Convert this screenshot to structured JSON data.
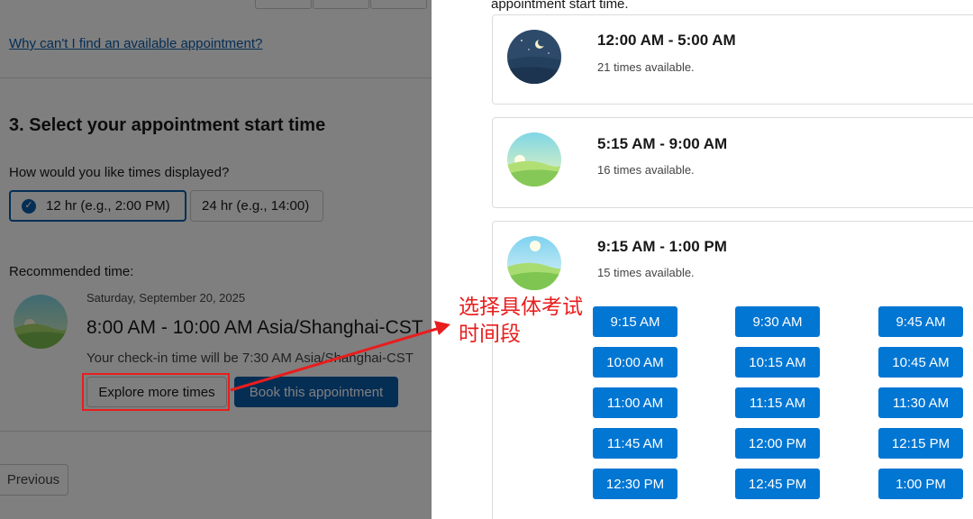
{
  "left_panel": {
    "why_link": "Why can't I find an available appointment?",
    "step_title": "3. Select your appointment start time",
    "format_question": "How would you like times displayed?",
    "format_options": [
      {
        "label": "12 hr (e.g., 2:00 PM)",
        "selected": true
      },
      {
        "label": "24 hr (e.g., 14:00)",
        "selected": false
      }
    ],
    "recommended_label": "Recommended time:",
    "recommended": {
      "date": "Saturday, September 20, 2025",
      "time_range": "8:00 AM - 10:00 AM Asia/Shanghai-CST",
      "checkin": "Your check-in time will be 7:30 AM Asia/Shanghai-CST"
    },
    "explore_button": "Explore more times",
    "book_button": "Book this appointment",
    "previous_button": "Previous"
  },
  "annotation": {
    "text_line1": "选择具体考试",
    "text_line2": "时间段",
    "color": "#e81d1d"
  },
  "right_panel": {
    "heading": "appointment start time.",
    "periods": [
      {
        "title": "12:00 AM - 5:00 AM",
        "availability": "21 times available.",
        "icon": "night-moon-icon"
      },
      {
        "title": "5:15 AM - 9:00 AM",
        "availability": "16 times available.",
        "icon": "sunrise-icon"
      },
      {
        "title": "9:15 AM - 1:00 PM",
        "availability": "15 times available.",
        "icon": "midday-sun-icon"
      }
    ],
    "time_slots": [
      "9:15 AM",
      "9:30 AM",
      "9:45 AM",
      "10:00 AM",
      "10:15 AM",
      "10:45 AM",
      "11:00 AM",
      "11:15 AM",
      "11:30 AM",
      "11:45 AM",
      "12:00 PM",
      "12:15 PM",
      "12:30 PM",
      "12:45 PM",
      "1:00 PM"
    ]
  },
  "colors": {
    "brand_blue": "#0176d3",
    "dark_blue": "#0b5cab",
    "annotation_red": "#e81d1d"
  }
}
